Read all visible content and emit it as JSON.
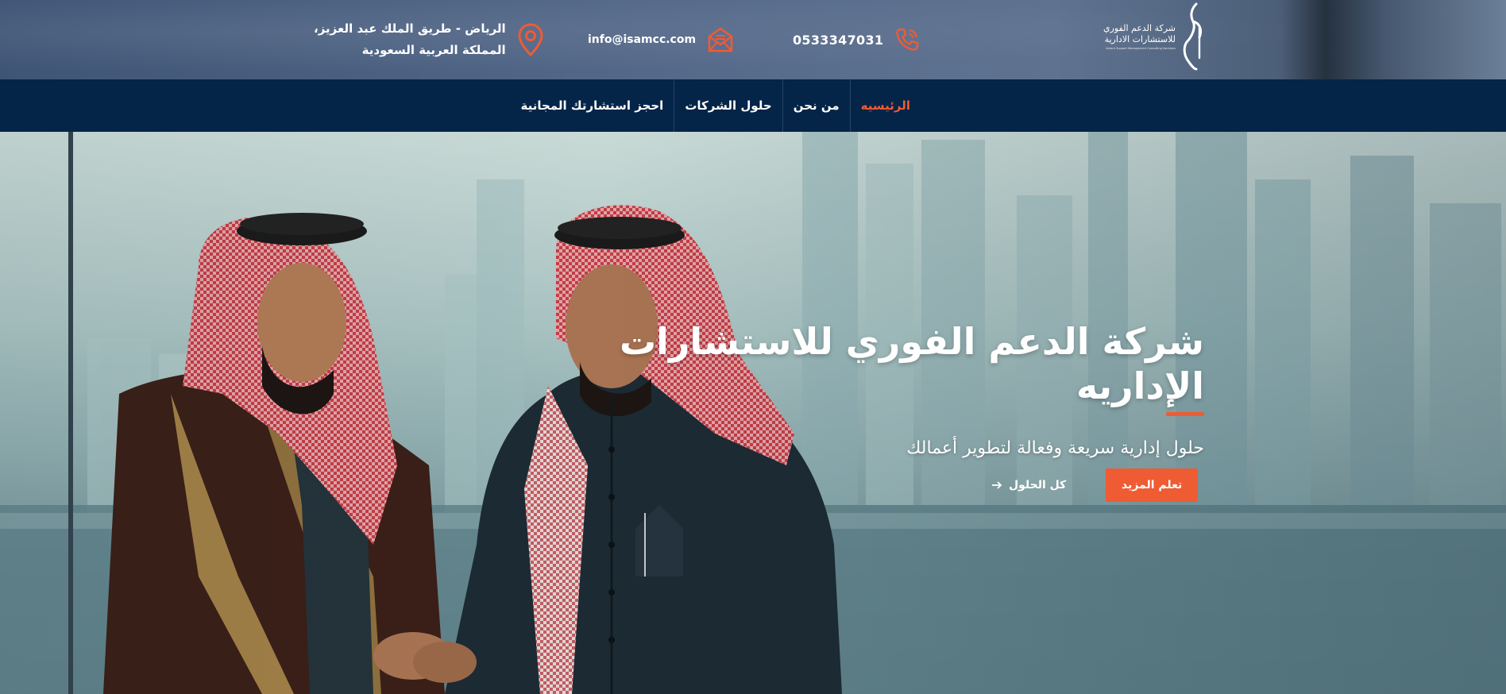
{
  "topbar": {
    "address_line1": "الرياض - طريق الملك عبد العزيز،",
    "address_line2": "المملكة العربية السعودية",
    "email": "info@isamcc.com",
    "phone": "0533347031",
    "icons": {
      "address": "map-pin-icon",
      "email": "envelope-icon",
      "phone": "phone-icon"
    }
  },
  "brand": {
    "name_line1": "شركة الدعم الفوري",
    "name_line2": "للاستشارات الادارية",
    "tagline": "Instant Support Management Consulting Solutions",
    "logo": "company-logo"
  },
  "nav": {
    "items": [
      {
        "label": "الرئيسيه",
        "active": true
      },
      {
        "label": "من نحن",
        "active": false
      },
      {
        "label": "حلول الشركات",
        "active": false
      },
      {
        "label": "احجز استشارتك المجانية",
        "active": false
      }
    ]
  },
  "hero": {
    "title": "شركة الدعم الفوري للاستشارات الإداريه",
    "subtitle": "حلول إدارية سريعة وفعالة لتطوير أعمالك",
    "primary_button": "تعلم المزيد",
    "secondary_link": "كل الحلول",
    "secondary_icon": "arrow-right-icon"
  },
  "colors": {
    "accent": "#ef5b33",
    "nav_bg": "#042548",
    "text_light": "#ffffff"
  }
}
